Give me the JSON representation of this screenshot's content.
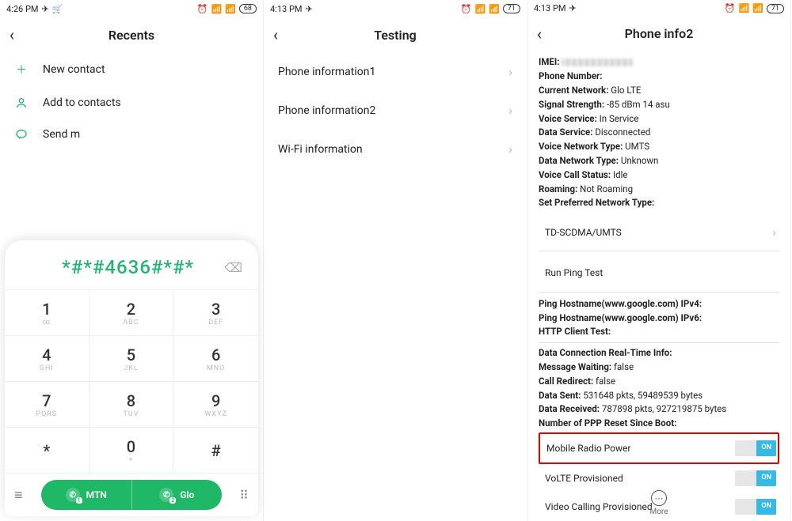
{
  "panel1": {
    "status": {
      "time": "4:26 PM",
      "battery": "68"
    },
    "title": "Recents",
    "options": [
      {
        "icon": "plus",
        "label": "New contact"
      },
      {
        "icon": "person",
        "label": "Add to contacts"
      },
      {
        "icon": "bubble",
        "label": "Send m"
      }
    ],
    "dialed": "*#*#4636#*#*",
    "keypad": [
      {
        "d": "1",
        "l": "∞"
      },
      {
        "d": "2",
        "l": "ABC"
      },
      {
        "d": "3",
        "l": "DEF"
      },
      {
        "d": "4",
        "l": "GHI"
      },
      {
        "d": "5",
        "l": "JKL"
      },
      {
        "d": "6",
        "l": "MNO"
      },
      {
        "d": "7",
        "l": "PQRS"
      },
      {
        "d": "8",
        "l": "TUV"
      },
      {
        "d": "9",
        "l": "WXYZ"
      },
      {
        "d": "*",
        "l": ""
      },
      {
        "d": "0",
        "l": "+"
      },
      {
        "d": "#",
        "l": ""
      }
    ],
    "sims": [
      {
        "badge": "1",
        "name": "MTN"
      },
      {
        "badge": "2",
        "name": "Glo"
      }
    ]
  },
  "panel2": {
    "status": {
      "time": "4:13 PM",
      "battery": "71"
    },
    "title": "Testing",
    "items": [
      "Phone information1",
      "Phone information2",
      "Wi-Fi information"
    ]
  },
  "panel3": {
    "status": {
      "time": "4:13 PM",
      "battery": "71"
    },
    "title": "Phone info2",
    "lines": {
      "imei_label": "IMEI:",
      "phone_number_label": "Phone Number:",
      "current_network": "Glo LTE",
      "signal_strength": "-85 dBm   14 asu",
      "voice_service": "In Service",
      "data_service": "Disconnected",
      "voice_network_type": "UMTS",
      "data_network_type": "Unknown",
      "voice_call_status": "Idle",
      "roaming": "Not Roaming",
      "set_pref_net_label": "Set Preferred Network Type:",
      "net_type_selected": "TD-SCDMA/UMTS",
      "run_ping": "Run Ping Test",
      "ping_v4": "Ping Hostname(www.google.com) IPv4:",
      "ping_v6": "Ping Hostname(www.google.com) IPv6:",
      "http_client": "HTTP Client Test:",
      "data_conn_rt": "Data Connection Real-Time Info:",
      "msg_waiting": "false",
      "call_redirect": "false",
      "data_sent": "531648 pkts, 59489539 bytes",
      "data_received": "787898 pkts, 927219875 bytes",
      "ppp_reset_label": "Number of PPP Reset Since Boot:"
    },
    "toggles": [
      {
        "label": "Mobile Radio Power",
        "state": "ON",
        "highlight": true
      },
      {
        "label": "VoLTE Provisioned",
        "state": "ON",
        "highlight": false
      },
      {
        "label": "Video Calling Provisioned",
        "state": "ON",
        "highlight": false
      }
    ],
    "more_label": "More"
  }
}
